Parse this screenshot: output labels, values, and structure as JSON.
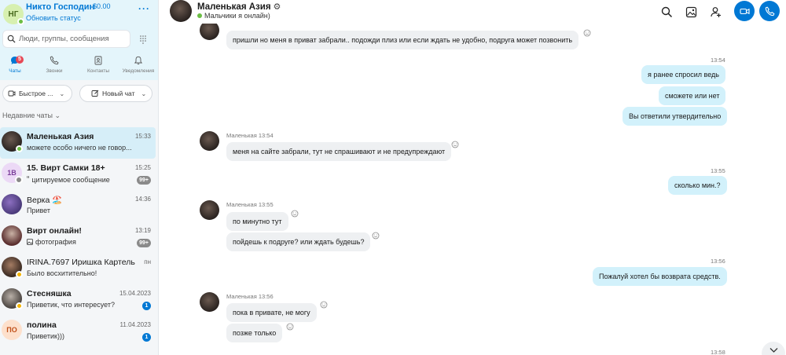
{
  "profile": {
    "initials": "НГ",
    "name": "Никто Господин",
    "balance": "$0.00",
    "status": "Обновить статус",
    "more_icon": "more-icon"
  },
  "search": {
    "placeholder": "Люди, группы, сообщения"
  },
  "nav": {
    "items": [
      {
        "label": "Чаты",
        "icon": "chat-icon",
        "badge": "5"
      },
      {
        "label": "Звонки",
        "icon": "phone-icon"
      },
      {
        "label": "Контакты",
        "icon": "contacts-icon"
      },
      {
        "label": "Уведомления",
        "icon": "bell-icon"
      }
    ]
  },
  "actions": {
    "quick": "Быстрое ...",
    "new_chat": "Новый чат"
  },
  "recent_label": "Недавние чаты",
  "chats": [
    {
      "name": "Маленькая Азия",
      "time": "15:33",
      "preview": "можете особо ничего не говор...",
      "presence": "green"
    },
    {
      "name": "15. Вирт Самки 18+",
      "initials": "1В",
      "time": "15:25",
      "preview": "цитируемое сообщение",
      "badge": "99+"
    },
    {
      "name": "Верка 🏖️",
      "time": "14:36",
      "preview": "Привет"
    },
    {
      "name": "Вирт онлайн!",
      "time": "13:19",
      "preview": "фотография",
      "badge": "99+"
    },
    {
      "name": "IRINA.7697 Иришка Картель",
      "time": "пн",
      "preview": "Было восхитительно!",
      "presence": "yellow"
    },
    {
      "name": "Стесняшка",
      "time": "15.04.2023",
      "preview": "Приветик, что интересует?",
      "badge": "1",
      "presence": "yellow"
    },
    {
      "name": "полина",
      "initials": "ПО",
      "time": "11.04.2023",
      "preview": "Приветик)))",
      "badge": "1"
    }
  ],
  "header": {
    "title": "Маленькая Азия",
    "members": "Мальчики я онлайн)",
    "icons": [
      "search-icon",
      "gallery-icon",
      "add-person-icon",
      "video-call-icon",
      "call-icon"
    ]
  },
  "messages": {
    "m1": "пришли но меня в приват забрали.. подожди плиз или если ждать не удобно, подруга может позвонить",
    "t1": "13:54",
    "o1": "я ранее спросил ведь",
    "o2": "сможете или нет",
    "o3": "Вы ответили утвердительно",
    "meta2": "Маленькая 13:54",
    "m2": "меня на сайте забрали, тут не спрашивают и не предупреждают",
    "t2": "13:55",
    "o4": "сколько мин.?",
    "meta3": "Маленькая 13:55",
    "m3": "по минутно тут",
    "m4": "пойдешь к подруге? или ждать будешь?",
    "t3": "13:56",
    "o5": "Пожалуй хотел бы возврата средств.",
    "meta4": "Маленькая 13:56",
    "m5": "пока в привате, не могу",
    "m6": "позже только",
    "t4": "13:58"
  }
}
